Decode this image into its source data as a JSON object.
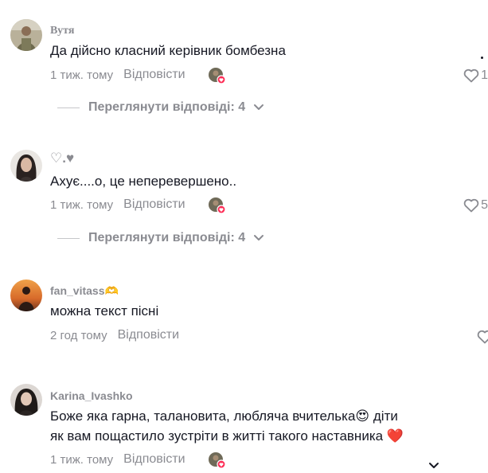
{
  "comments": [
    {
      "username": "Вутя",
      "text": "Да дійсно класний керівник бомбезна",
      "time": "1 тиж. тому",
      "reply": "Відповісти",
      "likes": "1",
      "view_replies": "Переглянути відповіді: 4"
    },
    {
      "username": "♡.♥",
      "text": "Ахує....о, це неперевершено..",
      "time": "1 тиж. тому",
      "reply": "Відповісти",
      "likes": "5",
      "view_replies": "Переглянути відповіді: 4"
    },
    {
      "username": "fan_vitass🫶",
      "text": "можна текст пісні",
      "time": "2 год тому",
      "reply": "Відповісти",
      "likes": ""
    },
    {
      "username": "Karina_Ivashko",
      "text_line1": "Боже яка гарна, талановита, любляча вчителька😍 діти",
      "text_line2": "як вам пощастило зустріти в житті такого наставника ❤️",
      "time": "1 тиж. тому",
      "reply": "Відповісти"
    }
  ],
  "colors": {
    "primary_text": "#161823",
    "secondary_text": "#8a8b91",
    "like_badge": "#fe2c55"
  }
}
